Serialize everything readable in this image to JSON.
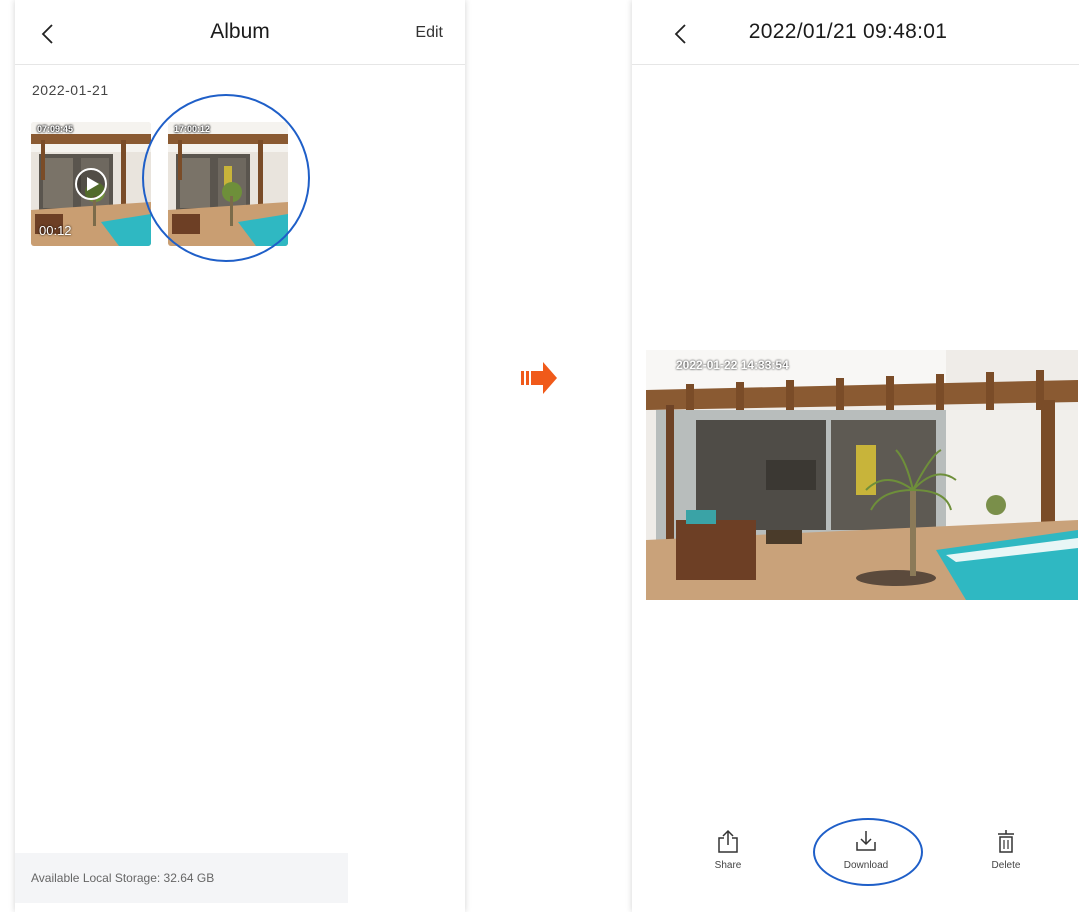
{
  "album": {
    "title": "Album",
    "edit_label": "Edit",
    "date_group": "2022-01-21",
    "items": [
      {
        "timestamp": "07:09:45",
        "type": "video",
        "duration": "00:12"
      },
      {
        "timestamp": "17:00:12",
        "type": "image"
      }
    ],
    "storage_text": "Available Local Storage: 32.64 GB"
  },
  "viewer": {
    "title": "2022/01/21 09:48:01",
    "photo_timestamp": "2022-01-22 14:33:54",
    "actions": {
      "share": "Share",
      "download": "Download",
      "delete": "Delete"
    }
  },
  "colors": {
    "highlight": "#1f5fc8",
    "arrow": "#f05a1a"
  },
  "icons": [
    "back-icon",
    "play-icon",
    "share-icon",
    "download-icon",
    "delete-icon",
    "arrow-right-icon"
  ]
}
